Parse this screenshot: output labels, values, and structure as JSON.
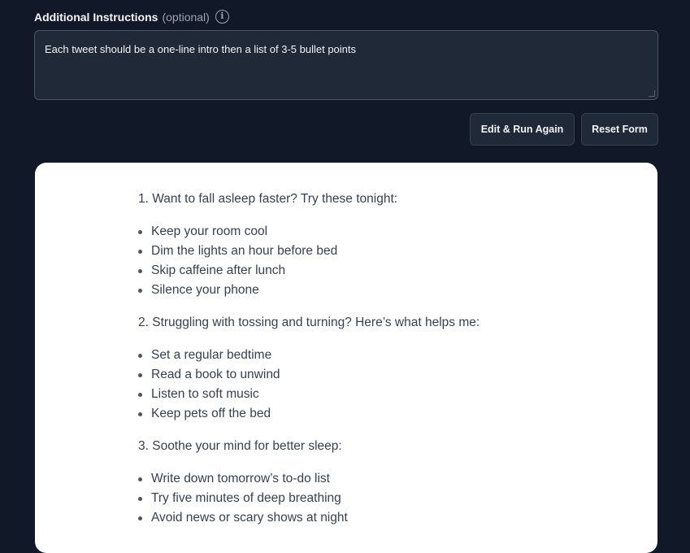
{
  "form": {
    "label": "Additional Instructions",
    "optional": "(optional)",
    "info_glyph": "i",
    "instructions_value": "Each tweet should be a one-line intro then a list of 3-5 bullet points",
    "edit_button": "Edit & Run Again",
    "reset_button": "Reset Form"
  },
  "output": {
    "tweets": [
      {
        "intro": "1. Want to fall asleep faster? Try these tonight:",
        "bullets": [
          "Keep your room cool",
          "Dim the lights an hour before bed",
          "Skip caffeine after lunch",
          "Silence your phone"
        ]
      },
      {
        "intro": "2. Struggling with tossing and turning? Here’s what helps me:",
        "bullets": [
          "Set a regular bedtime",
          "Read a book to unwind",
          "Listen to soft music",
          "Keep pets off the bed"
        ]
      },
      {
        "intro": "3. Soothe your mind for better sleep:",
        "bullets": [
          "Write down tomorrow’s to-do list",
          "Try five minutes of deep breathing",
          "Avoid news or scary shows at night"
        ]
      }
    ]
  },
  "colors": {
    "page_background": "#111827",
    "input_background": "#1f2937",
    "card_background": "#ffffff"
  }
}
